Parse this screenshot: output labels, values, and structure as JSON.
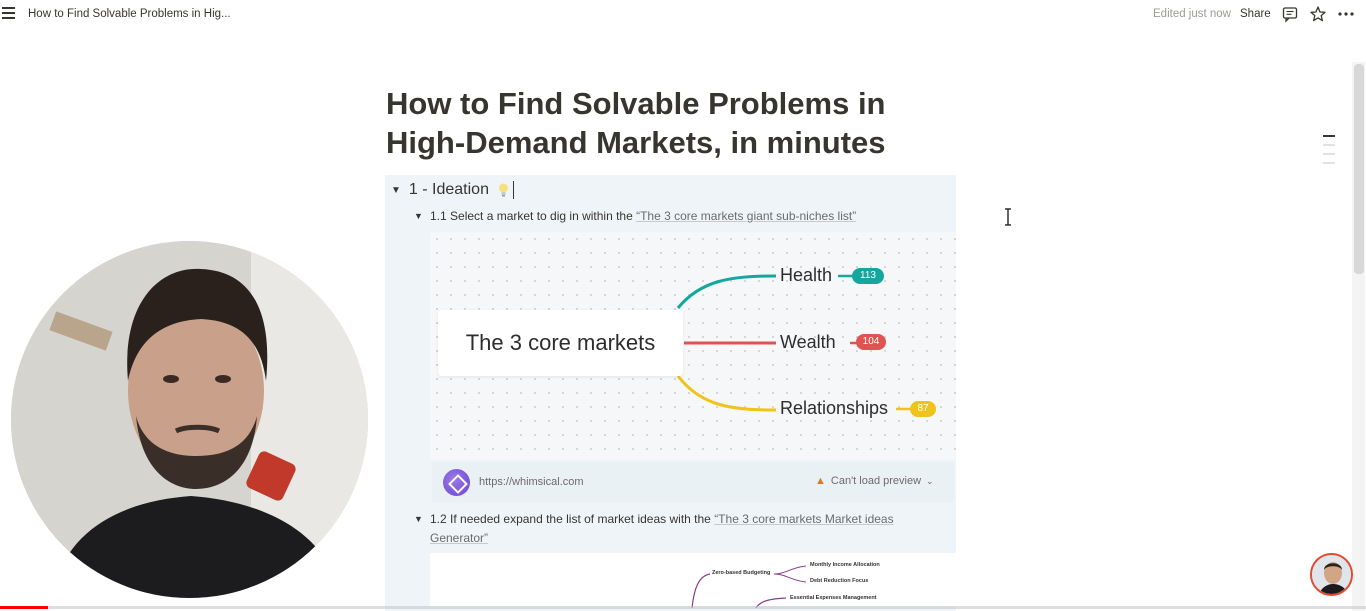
{
  "topbar": {
    "doc_title": "How to Find Solvable Problems in Hig...",
    "edited": "Edited just now",
    "share": "Share"
  },
  "page": {
    "title_line1": "How to Find Solvable Problems in",
    "title_line2": "High-Demand Markets, in minutes"
  },
  "toggle": {
    "heading": "1 - Ideation",
    "sub1_prefix": "1.1 Select a market to dig in within the ",
    "sub1_link": "“The 3 core markets giant sub-niches list”",
    "sub2_prefix": "1.2 If needed expand the list of market ideas with the ",
    "sub2_link_a": "“The 3 core markets Market ideas",
    "sub2_link_b": "Generator”"
  },
  "mindmap": {
    "core": "The 3 core markets",
    "nodes": [
      {
        "label": "Health",
        "count": "113",
        "color": "#14a7a0"
      },
      {
        "label": "Wealth",
        "count": "104",
        "color": "#e05353"
      },
      {
        "label": "Relationships",
        "count": "87",
        "color": "#f0c21c"
      }
    ]
  },
  "embed": {
    "url": "https://whimsical.com",
    "warning": "Can't load preview"
  },
  "mini_map": {
    "items": [
      "Zero-based Budgeting",
      "Monthly Income Allocation",
      "Debt Reduction Focus",
      "Essential Expenses Management"
    ]
  },
  "video": {
    "progress": 0.035
  },
  "icons": {
    "menu": "menu-icon",
    "comment": "comment-icon",
    "star": "star-icon",
    "more": "more-icon",
    "bulb": "lightbulb-icon",
    "warning": "warning-icon"
  }
}
